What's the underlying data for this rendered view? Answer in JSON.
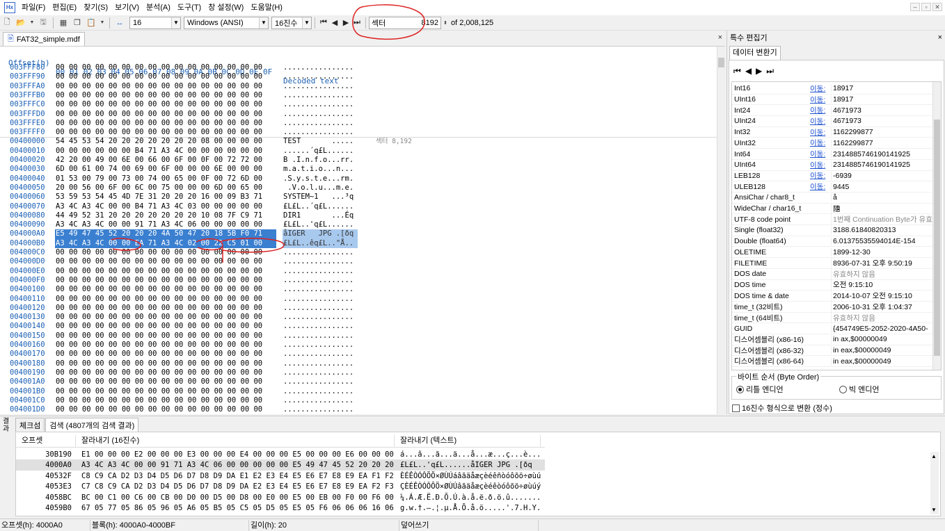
{
  "menu": [
    "파일(F)",
    "편집(E)",
    "찾기(S)",
    "보기(V)",
    "분석(A)",
    "도구(T)",
    "창 설정(W)",
    "도움말(H)"
  ],
  "toolbar": {
    "bytes_per_row": "16",
    "encoding": "Windows (ANSI)",
    "number_base": "16진수",
    "sector_label": "섹터",
    "sector_value": "8192",
    "sector_total": "of 2,008,125"
  },
  "file_tab": {
    "name": "FAT32_simple.mdf",
    "close": "×"
  },
  "hex": {
    "header_offset": "Offset(h)",
    "header_cols": "00 01 02 03 04 05 06 07 08 09 0A 0B 0C 0D 0E 0F",
    "header_text": "Decoded text",
    "sector_note": "섹터 8,192",
    "rows": [
      {
        "off": "003FFF80",
        "hex": "00 00 00 00 00 00 00 00 00 00 00 00 00 00 00 00",
        "txt": "................"
      },
      {
        "off": "003FFF90",
        "hex": "00 00 00 00 00 00 00 00 00 00 00 00 00 00 00 00",
        "txt": "................"
      },
      {
        "off": "003FFFA0",
        "hex": "00 00 00 00 00 00 00 00 00 00 00 00 00 00 00 00",
        "txt": "................"
      },
      {
        "off": "003FFFB0",
        "hex": "00 00 00 00 00 00 00 00 00 00 00 00 00 00 00 00",
        "txt": "................"
      },
      {
        "off": "003FFFC0",
        "hex": "00 00 00 00 00 00 00 00 00 00 00 00 00 00 00 00",
        "txt": "................"
      },
      {
        "off": "003FFFD0",
        "hex": "00 00 00 00 00 00 00 00 00 00 00 00 00 00 00 00",
        "txt": "................"
      },
      {
        "off": "003FFFE0",
        "hex": "00 00 00 00 00 00 00 00 00 00 00 00 00 00 00 00",
        "txt": "................"
      },
      {
        "off": "003FFFF0",
        "hex": "00 00 00 00 00 00 00 00 00 00 00 00 00 00 00 00",
        "txt": "................"
      },
      {
        "off": "00400000",
        "hex": "54 45 53 54 20 20 20 20 20 20 20 08 00 00 00 00",
        "txt": "TEST       ....."
      },
      {
        "off": "00400010",
        "hex": "00 00 00 00 00 00 B4 71 A3 4C 00 00 00 00 00 00",
        "txt": "......´q£L......"
      },
      {
        "off": "00400020",
        "hex": "42 20 00 49 00 6E 00 66 00 6F 00 0F 00 72 72 00",
        "txt": "B .I.n.f.o...rr."
      },
      {
        "off": "00400030",
        "hex": "6D 00 61 00 74 00 69 00 6F 00 00 00 6E 00 00 00",
        "txt": "m.a.t.i.o...n..."
      },
      {
        "off": "00400040",
        "hex": "01 53 00 79 00 73 00 74 00 65 00 0F 00 72 6D 00",
        "txt": ".S.y.s.t.e...rm."
      },
      {
        "off": "00400050",
        "hex": "20 00 56 00 6F 00 6C 00 75 00 00 00 6D 00 65 00",
        "txt": " .V.o.l.u...m.e."
      },
      {
        "off": "00400060",
        "hex": "53 59 53 54 45 4D 7E 31 20 20 20 16 00 09 B3 71",
        "txt": "SYSTEM~1   ...³q"
      },
      {
        "off": "00400070",
        "hex": "A3 4C A3 4C 00 00 B4 71 A3 4C 03 00 00 00 00 00",
        "txt": "£L£L..´q£L......"
      },
      {
        "off": "00400080",
        "hex": "44 49 52 31 20 20 20 20 20 20 20 10 08 7F C9 71",
        "txt": "DIR1       ...Éq"
      },
      {
        "off": "00400090",
        "hex": "A3 4C A3 4C 00 00 91 71 A3 4C 06 00 00 00 00 00",
        "txt": "£L£L..'q£L......"
      },
      {
        "off": "004000A0",
        "hex": "E5 49 47 45 52 20 20 20 4A 50 47 20 18 5B F0 71",
        "txt": "åIGER   JPG .[ðq"
      },
      {
        "off": "004000B0",
        "hex": "A3 4C A3 4C 00 00 EA 71 A3 4C 02 00 22 C5 01 00",
        "txt": "£L£L..êq£L..\"Å.."
      },
      {
        "off": "004000C0",
        "hex": "00 00 00 00 00 00 00 00 00 00 00 00 00 00 00 00",
        "txt": "................"
      },
      {
        "off": "004000D0",
        "hex": "00 00 00 00 00 00 00 00 00 00 00 00 00 00 00 00",
        "txt": "................"
      },
      {
        "off": "004000E0",
        "hex": "00 00 00 00 00 00 00 00 00 00 00 00 00 00 00 00",
        "txt": "................"
      },
      {
        "off": "004000F0",
        "hex": "00 00 00 00 00 00 00 00 00 00 00 00 00 00 00 00",
        "txt": "................"
      },
      {
        "off": "00400100",
        "hex": "00 00 00 00 00 00 00 00 00 00 00 00 00 00 00 00",
        "txt": "................"
      },
      {
        "off": "00400110",
        "hex": "00 00 00 00 00 00 00 00 00 00 00 00 00 00 00 00",
        "txt": "................"
      },
      {
        "off": "00400120",
        "hex": "00 00 00 00 00 00 00 00 00 00 00 00 00 00 00 00",
        "txt": "................"
      },
      {
        "off": "00400130",
        "hex": "00 00 00 00 00 00 00 00 00 00 00 00 00 00 00 00",
        "txt": "................"
      },
      {
        "off": "00400140",
        "hex": "00 00 00 00 00 00 00 00 00 00 00 00 00 00 00 00",
        "txt": "................"
      },
      {
        "off": "00400150",
        "hex": "00 00 00 00 00 00 00 00 00 00 00 00 00 00 00 00",
        "txt": "................"
      },
      {
        "off": "00400160",
        "hex": "00 00 00 00 00 00 00 00 00 00 00 00 00 00 00 00",
        "txt": "................"
      },
      {
        "off": "00400170",
        "hex": "00 00 00 00 00 00 00 00 00 00 00 00 00 00 00 00",
        "txt": "................"
      },
      {
        "off": "00400180",
        "hex": "00 00 00 00 00 00 00 00 00 00 00 00 00 00 00 00",
        "txt": "................"
      },
      {
        "off": "00400190",
        "hex": "00 00 00 00 00 00 00 00 00 00 00 00 00 00 00 00",
        "txt": "................"
      },
      {
        "off": "004001A0",
        "hex": "00 00 00 00 00 00 00 00 00 00 00 00 00 00 00 00",
        "txt": "................"
      },
      {
        "off": "004001B0",
        "hex": "00 00 00 00 00 00 00 00 00 00 00 00 00 00 00 00",
        "txt": "................"
      },
      {
        "off": "004001C0",
        "hex": "00 00 00 00 00 00 00 00 00 00 00 00 00 00 00 00",
        "txt": "................"
      },
      {
        "off": "004001D0",
        "hex": "00 00 00 00 00 00 00 00 00 00 00 00 00 00 00 00",
        "txt": "................"
      }
    ]
  },
  "right_panel": {
    "title": "특수 편집기",
    "close": "×",
    "tab": "데이터 변환기",
    "goto": "이동:",
    "rows": [
      {
        "name": "Int16",
        "link": true,
        "value": "18917",
        "gray": false
      },
      {
        "name": "UInt16",
        "link": true,
        "value": "18917",
        "gray": false
      },
      {
        "name": "Int24",
        "link": true,
        "value": "4671973",
        "gray": false
      },
      {
        "name": "UInt24",
        "link": true,
        "value": "4671973",
        "gray": false
      },
      {
        "name": "Int32",
        "link": true,
        "value": "1162299877",
        "gray": false
      },
      {
        "name": "UInt32",
        "link": true,
        "value": "1162299877",
        "gray": false
      },
      {
        "name": "Int64",
        "link": true,
        "value": "2314885746190141925",
        "gray": false
      },
      {
        "name": "UInt64",
        "link": true,
        "value": "2314885746190141925",
        "gray": false
      },
      {
        "name": "LEB128",
        "link": true,
        "value": "-6939",
        "gray": false
      },
      {
        "name": "ULEB128",
        "link": true,
        "value": "9445",
        "gray": false
      },
      {
        "name": "AnsiChar / char8_t",
        "link": false,
        "value": "å",
        "gray": false
      },
      {
        "name": "WideChar / char16_t",
        "link": false,
        "value": "䧥",
        "gray": false
      },
      {
        "name": "UTF-8 code point",
        "link": false,
        "value": "1번째 Continuation Byte가 유효",
        "gray": true
      },
      {
        "name": "Single (float32)",
        "link": false,
        "value": "3188.61840820313",
        "gray": false
      },
      {
        "name": "Double (float64)",
        "link": false,
        "value": "6.01375535594014E-154",
        "gray": false
      },
      {
        "name": "OLETIME",
        "link": false,
        "value": "1899-12-30",
        "gray": false
      },
      {
        "name": "FILETIME",
        "link": false,
        "value": "8936-07-31 오후 9:50:19",
        "gray": false
      },
      {
        "name": "DOS date",
        "link": false,
        "value": "유효하지 않음",
        "gray": true
      },
      {
        "name": "DOS time",
        "link": false,
        "value": "오전 9:15:10",
        "gray": false
      },
      {
        "name": "DOS time & date",
        "link": false,
        "value": "2014-10-07 오전 9:15:10",
        "gray": false
      },
      {
        "name": "time_t (32비트)",
        "link": false,
        "value": "2006-10-31 오후 1:04:37",
        "gray": false
      },
      {
        "name": "time_t (64비트)",
        "link": false,
        "value": "유효하지 않음",
        "gray": true
      },
      {
        "name": "GUID",
        "link": false,
        "value": "{454749E5-2052-2020-4A50-",
        "gray": false
      },
      {
        "name": "디스어셈블리 (x86-16)",
        "link": false,
        "value": "in ax,$00000049",
        "gray": false
      },
      {
        "name": "디스어셈블리 (x86-32)",
        "link": false,
        "value": "in eax,$00000049",
        "gray": false
      },
      {
        "name": "디스어셈블리 (x86-64)",
        "link": false,
        "value": "in eax,$00000049",
        "gray": false
      }
    ],
    "byte_order_label": "바이트 순서 (Byte Order)",
    "little_endian": "리틀 엔디언",
    "big_endian": "빅 엔디언",
    "hex_format_label": "16진수 형식으로 변환 (정수)"
  },
  "bottom": {
    "side_label": "결과",
    "tabs": [
      "체크섬",
      "검색 (4807개의 검색 결과)"
    ],
    "headers": [
      "오프셋",
      "잘라내기 (16진수)",
      "잘라내기 (텍스트)"
    ],
    "rows": [
      {
        "off": "30B190",
        "hex": "E1 00 00 00 E2 00 00 00 E3 00 00 00 E4 00 00 00 E5 00 00 00 E6 00 00 00 E7 00 00 00 E8 00...",
        "txt": "á...â...ã...ä...å...æ...ç...è...",
        "sel": false
      },
      {
        "off": "4000A0",
        "hex": "A3 4C A3 4C 00 00 91 71 A3 4C 06 00 00 00 00 00 E5 49 47 45 52 20 20 20 4A 50 47 20 18 ...",
        "txt": "£L£L..'q£L......åIGER   JPG .[ðq",
        "sel": true
      },
      {
        "off": "40532F",
        "hex": "C8 C9 CA D2 D3 D4 D5 D6 D7 D8 D9 DA E1 E2 E3 E4 E5 E6 E7 E8 E9 EA F1 F2 F3 F4 F5 F6 F7 ...",
        "txt": "ÈÉÊÒÓÔÕÖ×ØÙÚáâãäåæçèéêñòóôõö÷øùú",
        "sel": false
      },
      {
        "off": "4053E3",
        "hex": "C7 C8 C9 CA D2 D3 D4 D5 D6 D7 D8 D9 DA E2 E3 E4 E5 E6 E7 E8 E9 EA F2 F3 F4 F5 F6 F7 F8...",
        "txt": "ÇÈÉÊÒÓÔÕÖ×ØÙÚâãäåæçèéêòóôõö÷øùúý",
        "sel": false
      },
      {
        "off": "4058BC",
        "hex": "BC 00 C1 00 C6 00 CB 00 D0 00 D5 00 D8 00 E0 00 E5 00 EB 00 F0 00 F6 00 FB 01 01 01 07 ...",
        "txt": "¼.Á.Æ.Ë.Ð.Õ.Ú.à.å.ë.ð.ö.û.......",
        "sel": false
      },
      {
        "off": "4059B0",
        "hex": "67 05 77 05 86 05 96 05 A6 05 B5 05 C5 05 D5 05 E5 05 F6 06 06 06 16 06 27 06 37 06 48 ...",
        "txt": "g.w.†.–.¦.µ.Å.Õ.å.ö.....'.7.H.Y.",
        "sel": false
      }
    ]
  },
  "status": {
    "offset": "오프셋(h): 4000A0",
    "block": "블록(h): 4000A0-4000BF",
    "length": "길이(h): 20",
    "mode": "덮어쓰기"
  }
}
